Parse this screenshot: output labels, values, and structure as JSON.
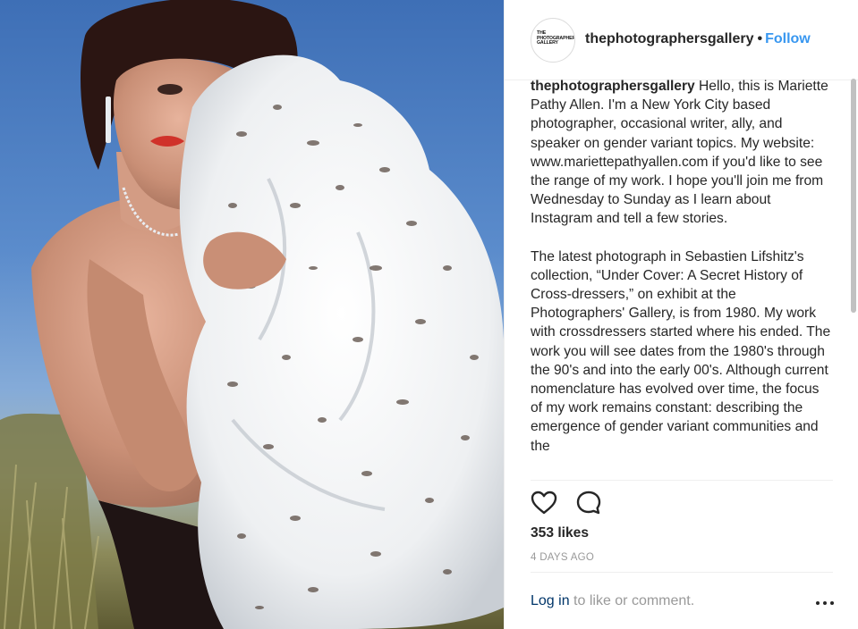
{
  "post": {
    "image_alt": "Woman with short dark curly hair, red lipstick, dangling earrings and a rhinestone necklace, hugging a white spotted faux fur coat against a blue sky and beach grass."
  },
  "header": {
    "avatar_text": "THE PHOTOGRAPHERS' GALLERY",
    "username": "thephotographersgallery",
    "separator": "•",
    "follow_label": "Follow"
  },
  "caption": {
    "username": "thephotographersgallery",
    "paragraph1": "Hello, this is Mariette Pathy Allen. I'm a New York City based photographer, occasional writer, ally, and speaker on gender variant topics. My website: www.mariettepathyallen.com if you'd like to see the range of my work. I hope you'll join me from Wednesday to Sunday as I learn about Instagram and tell a few stories.",
    "paragraph2": "The latest photograph in Sebastien Lifshitz's collection, “Under Cover: A Secret History of Cross-dressers,” on exhibit at the Photographers' Gallery, is from 1980. My work with crossdressers started where his ended. The work you will see dates from the 1980's through the 90's and into the early 00's. Although current nomenclature has evolved over time, the focus of my work remains constant: describing the emergence of gender variant communities and the"
  },
  "stats": {
    "likes": "353 likes",
    "time_ago": "4 DAYS AGO"
  },
  "comment_bar": {
    "login_label": "Log in",
    "login_suffix": " to like or comment."
  },
  "colors": {
    "accent": "#3897f0",
    "login_link": "#003569",
    "muted": "#999999",
    "text": "#262626",
    "divider": "#efefef"
  },
  "icons": {
    "like": "heart-outline-icon",
    "comment": "speech-bubble-icon",
    "more": "more-options-icon"
  }
}
